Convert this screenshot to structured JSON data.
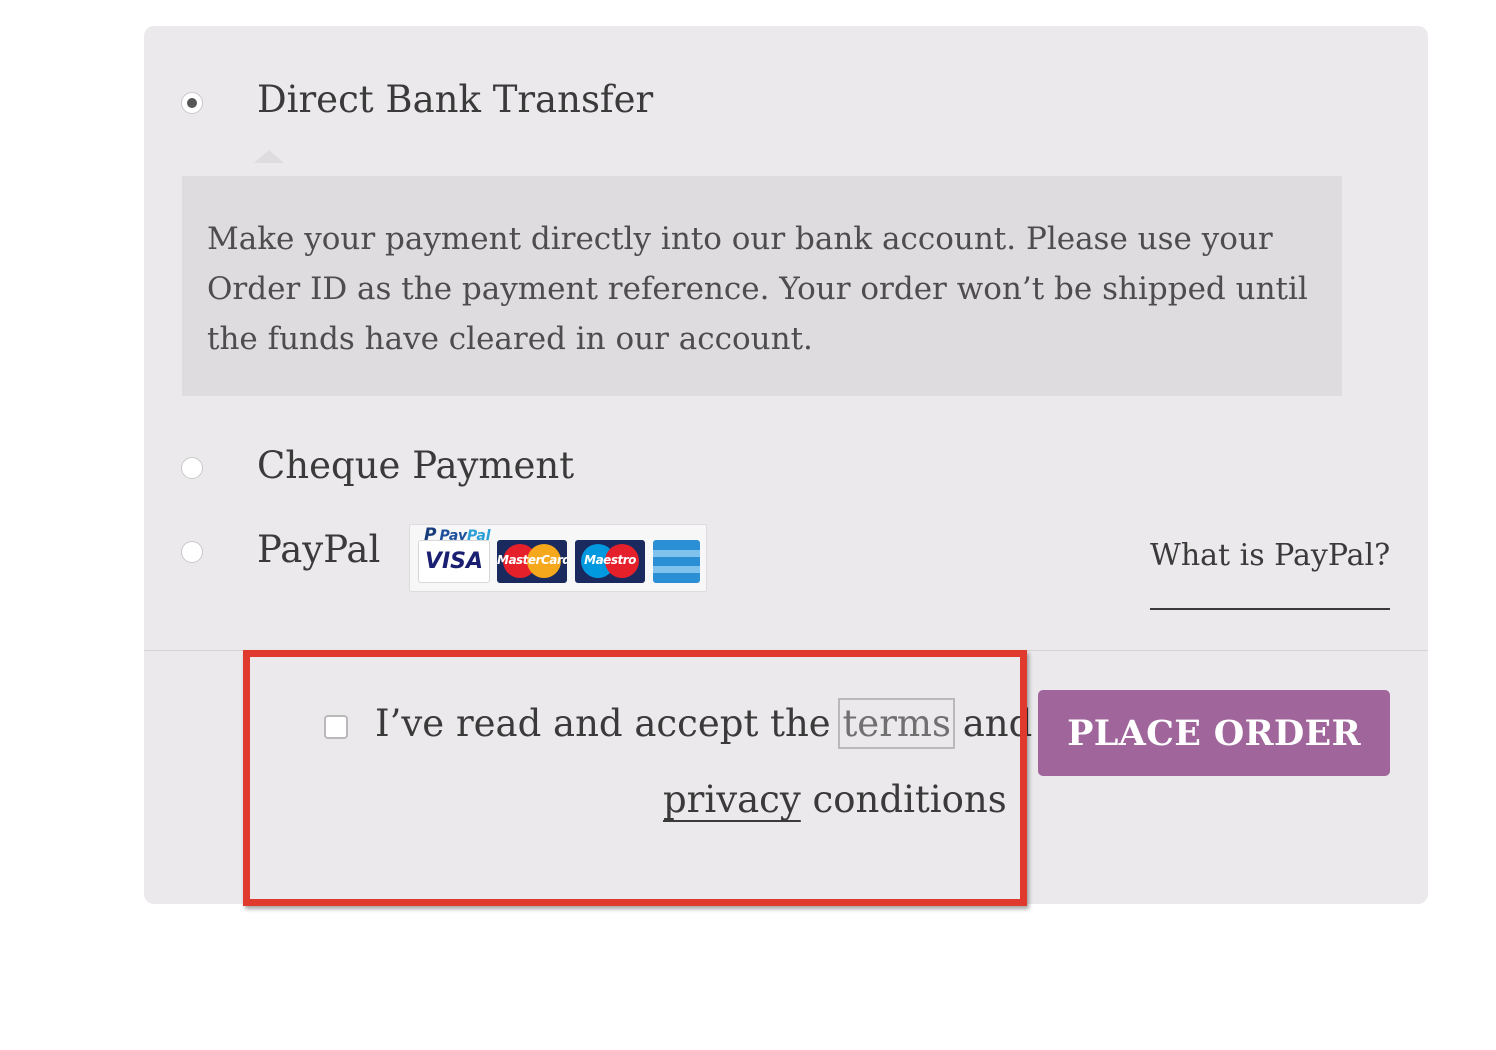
{
  "payment_methods": [
    {
      "label": "Direct Bank Transfer",
      "selected": true
    },
    {
      "label": "Cheque Payment",
      "selected": false
    },
    {
      "label": "PayPal",
      "selected": false
    }
  ],
  "bank_description": "Make your payment directly into our bank account. Please use your Order ID as the payment reference. Your order won’t be shipped until the funds have cleared in our account.",
  "paypal": {
    "brand_pay": "Pay",
    "brand_pal": "Pal",
    "card_visa": "VISA",
    "card_mastercard": "MasterCard",
    "card_maestro": "Maestro",
    "what_is_link": "What is PayPal?"
  },
  "terms": {
    "prefix": "I’ve read and accept the ",
    "terms_link": "terms",
    "middle": " and",
    "privacy_link": "privacy",
    "suffix": " conditions",
    "checked": false
  },
  "place_order_label": "PLACE ORDER",
  "colors": {
    "panel_bg": "#ebe9eb",
    "button_bg": "#a0659b",
    "highlight": "#e03a2e"
  }
}
